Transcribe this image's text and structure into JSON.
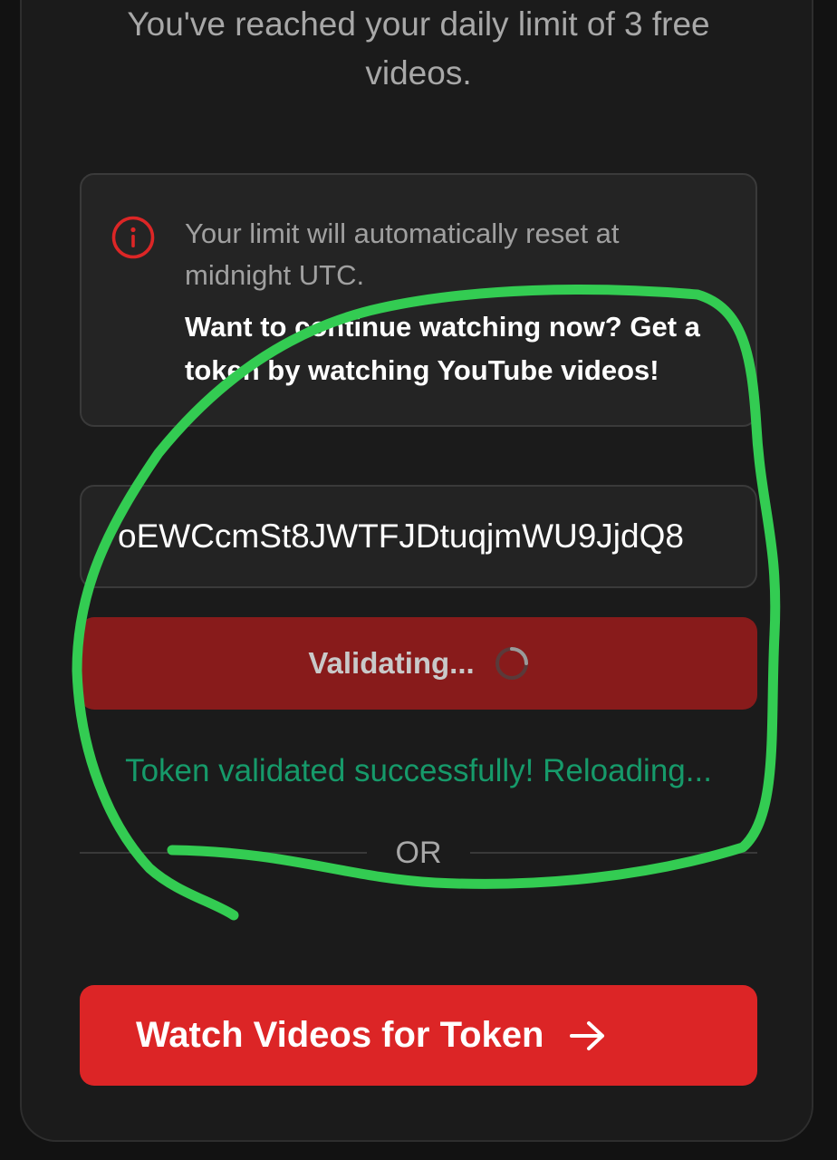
{
  "header": {
    "subtitle_line1": "You've reached your daily limit of 3 free",
    "subtitle_line2": "videos."
  },
  "info": {
    "icon": "info-circle-icon",
    "icon_color": "#dc2626",
    "secondary_text": "Your limit will automatically reset at midnight UTC.",
    "primary_text": "Want to continue watching now? Get a token by watching YouTube videos!"
  },
  "token_input": {
    "value": "oEWCcmSt8JWTFJDtuqjmWU9JjdQ8"
  },
  "validate_button": {
    "label": "Validating...",
    "icon": "spinner-icon"
  },
  "status": {
    "message": "Token validated successfully! Reloading...",
    "color": "#169a6a"
  },
  "divider": {
    "label": "OR"
  },
  "watch_button": {
    "label": "Watch Videos for Token",
    "icon": "arrow-right-icon",
    "color": "#dc2526"
  },
  "annotation": {
    "shape": "hand-drawn-circle",
    "color": "#33cc52"
  }
}
